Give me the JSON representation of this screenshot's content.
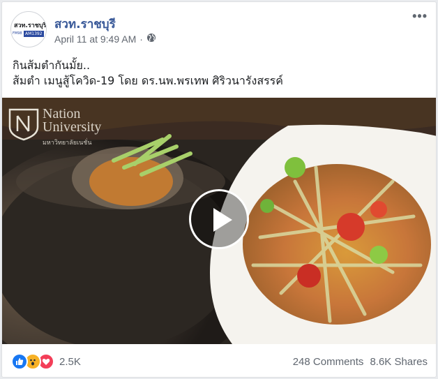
{
  "post": {
    "page_name": "สวท.ราชบุรี",
    "avatar_text": "สวท.ราชบุรี",
    "avatar_badge": "AM1392",
    "avatar_badge_small": "FM98",
    "timestamp": "April 11 at 9:49 AM",
    "separator": "·",
    "audience_icon": "globe-icon",
    "more_icon": "more-options-icon",
    "more_label": "•••",
    "text_line1": "กินส้มตำกันมั้ย..",
    "text_line2": "ส้มตำ เมนูสู้โควิด-19 โดย ดร.นพ.พรเทพ ศิริวนารังสรรค์"
  },
  "video": {
    "watermark_title_line1": "Nation",
    "watermark_title_line2": "University",
    "watermark_subtitle": "มหาวิทยาลัยเนชั่น",
    "play_icon": "play-icon"
  },
  "footer": {
    "reactions": [
      "like-icon",
      "wow-icon",
      "love-icon"
    ],
    "reaction_count": "2.5K",
    "comments": "248 Comments",
    "shares": "8.6K Shares"
  },
  "colors": {
    "link": "#385898",
    "like": "#1877f2",
    "wow": "#f7b125",
    "love": "#f33e58"
  }
}
